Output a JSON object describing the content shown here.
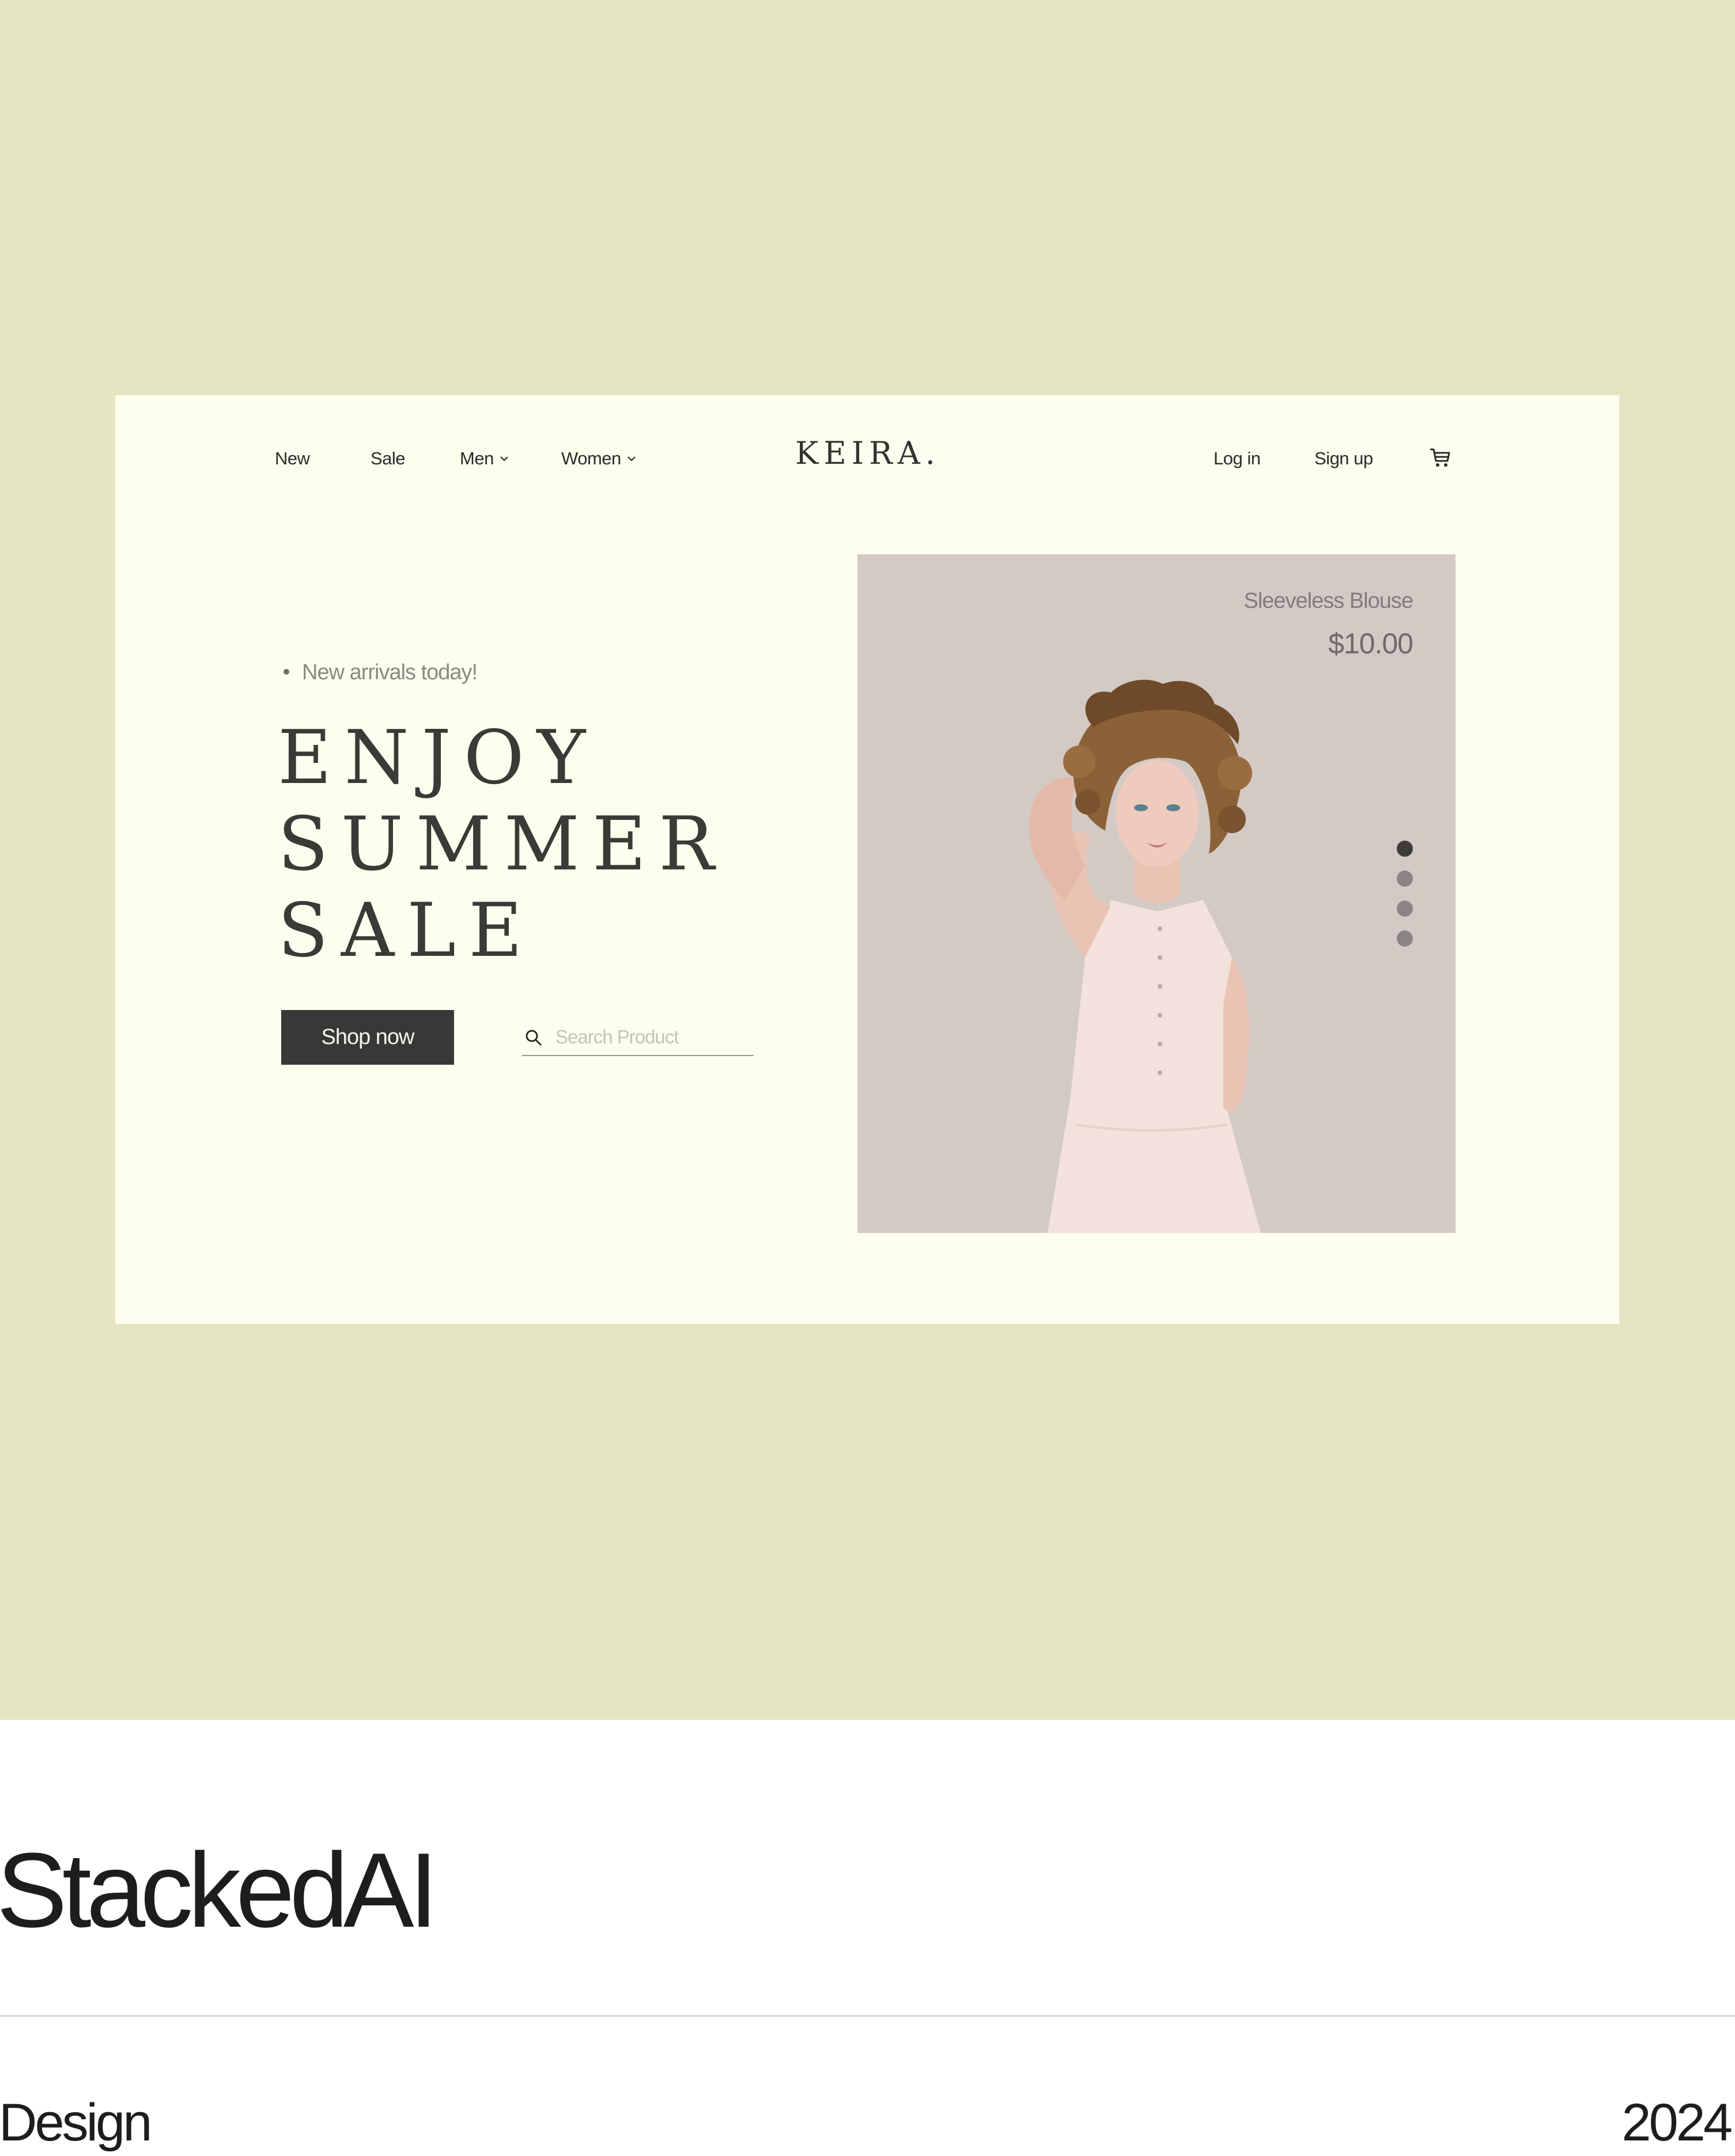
{
  "nav": {
    "left_items": [
      {
        "label": "New"
      },
      {
        "label": "Sale"
      },
      {
        "label": "Men"
      },
      {
        "label": "Women"
      }
    ],
    "logo": "KEIRA.",
    "login": "Log in",
    "signup": "Sign up",
    "cart_icon": "cart-icon"
  },
  "hero": {
    "tagline": "New arrivals today!",
    "headline": [
      "ENJOY",
      "SUMMER",
      "SALE"
    ],
    "cta_label": "Shop now",
    "search_placeholder": "Search Product",
    "search_icon": "search-icon"
  },
  "product": {
    "name": "Sleeveless Blouse",
    "price": "$10.00",
    "carousel": {
      "count": 4,
      "active_index": 0
    }
  },
  "caption": {
    "brand": "StackedAI",
    "category": "Design",
    "year": "2024"
  },
  "colors": {
    "band_bg": "#e4e4c3",
    "card_bg": "#fefeef",
    "panel_bg": "#d4cac5",
    "button_bg": "#383837",
    "text_dark": "#2b2b2b"
  }
}
